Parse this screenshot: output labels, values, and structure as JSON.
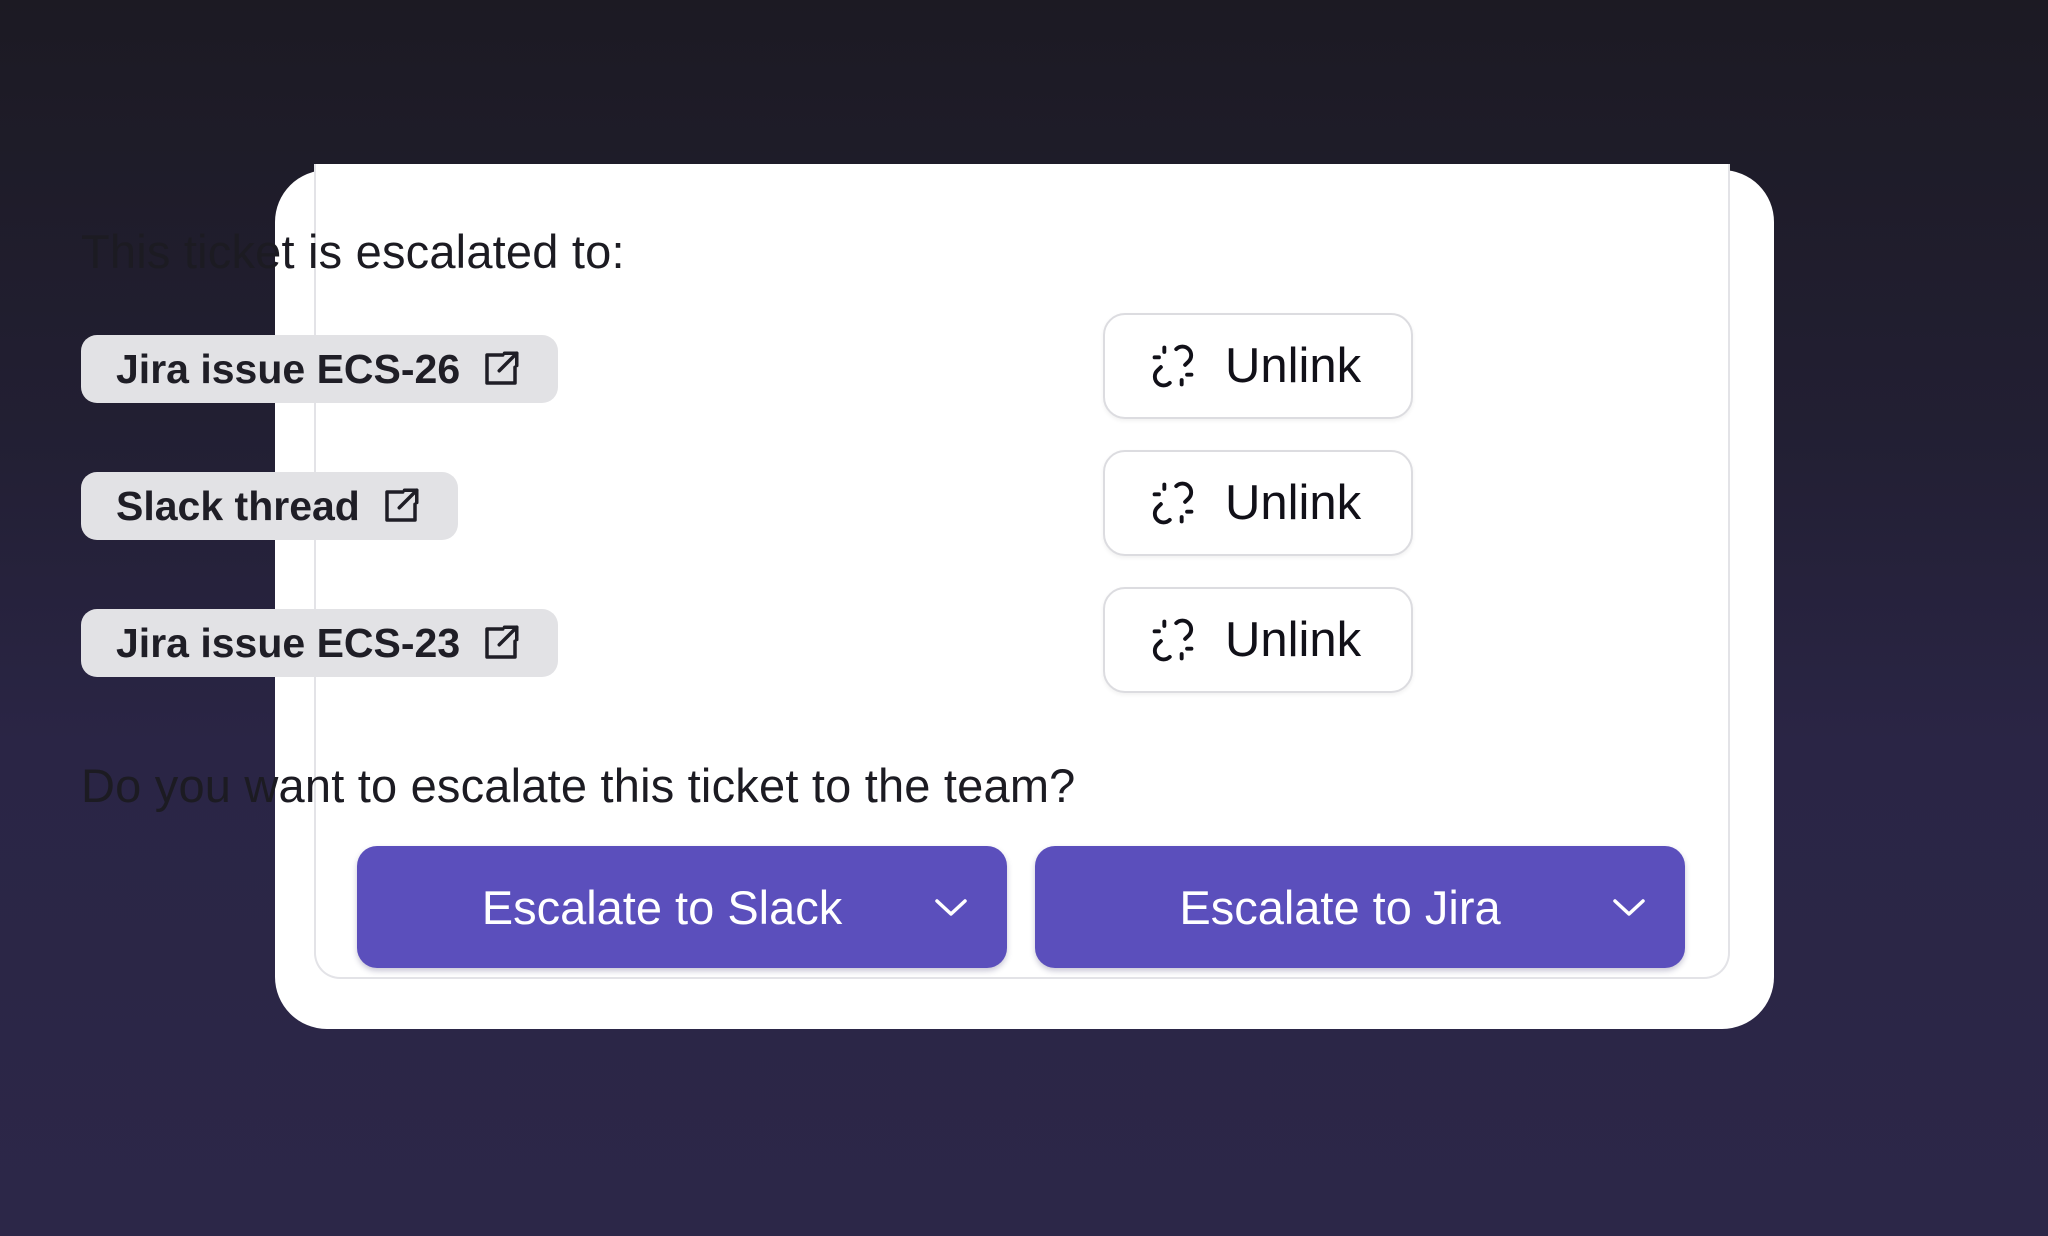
{
  "escalated_heading": "This ticket is escalated to:",
  "links": [
    {
      "label": "Jira issue ECS-26",
      "icon": "external-link-icon",
      "action_label": "Unlink",
      "action_icon": "broken-link-icon"
    },
    {
      "label": "Slack thread",
      "icon": "external-link-icon",
      "action_label": "Unlink",
      "action_icon": "broken-link-icon"
    },
    {
      "label": "Jira issue ECS-23",
      "icon": "external-link-icon",
      "action_label": "Unlink",
      "action_icon": "broken-link-icon"
    }
  ],
  "question": "Do you want to escalate this ticket to the team?",
  "actions": {
    "slack_label": "Escalate to Slack",
    "jira_label": "Escalate to Jira",
    "dropdown_icon": "chevron-down-icon"
  },
  "colors": {
    "primary": "#5b4fbc",
    "chip_bg": "#e2e2e5",
    "card_bg": "#ffffff",
    "page_bg_top": "#1c1a23",
    "page_bg_bottom": "#2c2748"
  }
}
